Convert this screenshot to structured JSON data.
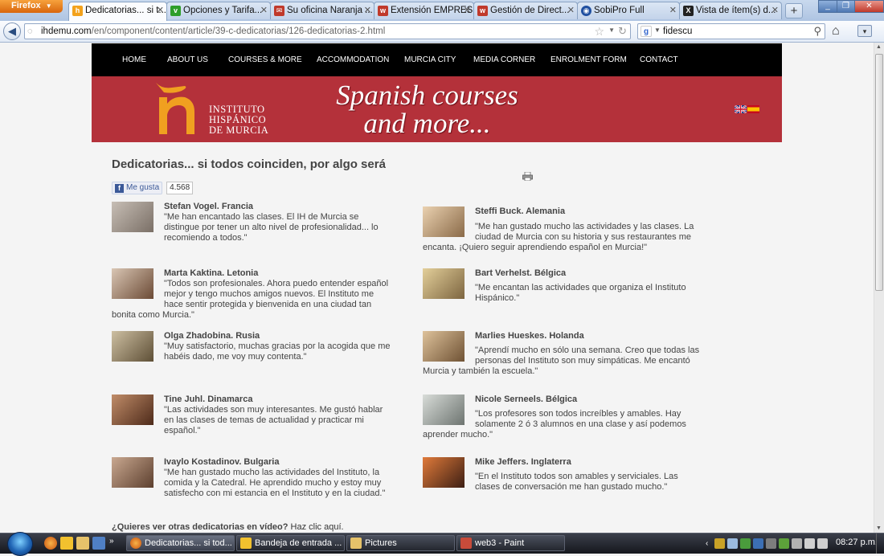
{
  "browser": {
    "menu_label": "Firefox",
    "tabs": [
      {
        "title": "Dedicatorias... si t...",
        "active": true,
        "favicon_color": "#f3a21c"
      },
      {
        "title": "Opciones y Tarifa...",
        "active": false,
        "favicon_color": "#2e9e2a"
      },
      {
        "title": "Su oficina Naranja ...",
        "active": false,
        "favicon_color": "#c0392b"
      },
      {
        "title": "Extensión EMPRES...",
        "active": false,
        "favicon_color": "#c0392b"
      },
      {
        "title": "Gestión de Direct...",
        "active": false,
        "favicon_color": "#c0392b"
      },
      {
        "title": "SobiPro Full",
        "active": false,
        "favicon_color": "#1f4fa0"
      },
      {
        "title": "Vista de ítem(s) d...",
        "active": false,
        "favicon_color": "#222222"
      }
    ],
    "url_domain": "ihdemu.com",
    "url_path": "/en/component/content/article/39-c-dedicatorias/126-dedicatorias-2.html",
    "search_value": "fidescu"
  },
  "site": {
    "nav": [
      {
        "label": "HOME"
      },
      {
        "label": "ABOUT US"
      },
      {
        "label": "COURSES & MORE"
      },
      {
        "label": "ACCOMMODATION"
      },
      {
        "label": "MURCIA CITY"
      },
      {
        "label": "MEDIA CORNER"
      },
      {
        "label": "ENROLMENT FORM"
      },
      {
        "label": "CONTACT"
      }
    ],
    "banner": {
      "logo_line1": "INSTITUTO",
      "logo_line2": "HISPÁNICO",
      "logo_line3": "DE MURCIA",
      "tagline_line1": "Spanish courses",
      "tagline_line2": "and more...",
      "brand_red": "#b4313a",
      "logo_orange": "#f0a020"
    }
  },
  "article": {
    "title": "Dedicatorias... si todos coinciden, por algo será",
    "like_label": "Me gusta",
    "like_count": "4.568",
    "testimonials_left": [
      {
        "name": "Stefan Vogel. Francia",
        "quote": "\"Me han encantado las clases. El IH de Murcia se distingue por tener un alto nivel de profesionalidad... lo recomiendo a todos.\"",
        "photo_color": "#9a8f86"
      },
      {
        "name": "Marta Kaktina. Letonia",
        "quote": "\"Todos son profesionales. Ahora puedo entender español mejor y tengo muchos amigos nuevos. El Instituto me hace sentir protegida y bienvenida en una ciudad tan bonita como Murcia.\"",
        "photo_color": "#8a6a55"
      },
      {
        "name": "Olga Zhadobina. Rusia",
        "quote": "\"Muy satisfactorio, muchas gracias por la acogida que me habéis dado, me voy muy contenta.\"",
        "photo_color": "#7a6a4f"
      },
      {
        "name": "Tine Juhl. Dinamarca",
        "quote": "\"Las actividades son muy interesantes. Me gustó hablar en las clases de temas de actualidad y practicar mi español.\"",
        "photo_color": "#7b4a32"
      },
      {
        "name": "Ivaylo Kostadinov. Bulgaria",
        "quote": "\"Me han gustado mucho las actividades del Instituto, la comida y la Catedral. He aprendido mucho y estoy muy satisfecho con mi estancia en el Instituto y en la ciudad.\"",
        "photo_color": "#8f6a55"
      }
    ],
    "testimonials_right": [
      {
        "name": "Steffi Buck. Alemania",
        "quote": "\"Me han gustado mucho las actividades y las clases. La ciudad de Murcia con su historia y sus restaurantes me encanta. ¡Quiero seguir aprendiendo español en Murcia!\"",
        "photo_color": "#c9a27a"
      },
      {
        "name": "Bart Verhelst. Bélgica",
        "quote": "\"Me encantan las actividades que organiza el Instituto Hispánico.\"",
        "photo_color": "#b89a6f"
      },
      {
        "name": "Marlies Hueskes. Holanda",
        "quote": "\"Aprendí mucho en sólo una semana. Creo que todas las personas del Instituto son muy simpáticas. Me encantó Murcia y también la escuela.\"",
        "photo_color": "#b08a5f"
      },
      {
        "name": "Nicole Serneels. Bélgica",
        "quote": "\"Los profesores son todos increíbles y amables. Hay solamente 2 ó 3 alumnos en una clase y así podemos aprender mucho.\"",
        "photo_color": "#9aa3a0"
      },
      {
        "name": "Mike Jeffers. Inglaterra",
        "quote": "\"En el Instituto todos son amables y serviciales. Las clases de conversación me han gustado mucho.\"",
        "photo_color": "#d0582a"
      }
    ],
    "video_question": "¿Quieres ver otras dedicatorias en vídeo?",
    "video_link": "Haz clic aquí."
  },
  "taskbar": {
    "tasks": [
      {
        "label": "Dedicatorias... si tod...",
        "active": true,
        "icon_color": "#e8731c"
      },
      {
        "label": "Bandeja de entrada ...",
        "active": false,
        "icon_color": "#f2c12e"
      },
      {
        "label": "Pictures",
        "active": false,
        "icon_color": "#e6c26a"
      },
      {
        "label": "web3 - Paint",
        "active": false,
        "icon_color": "#c84b3a"
      }
    ],
    "clock": "08:27 p.m."
  }
}
